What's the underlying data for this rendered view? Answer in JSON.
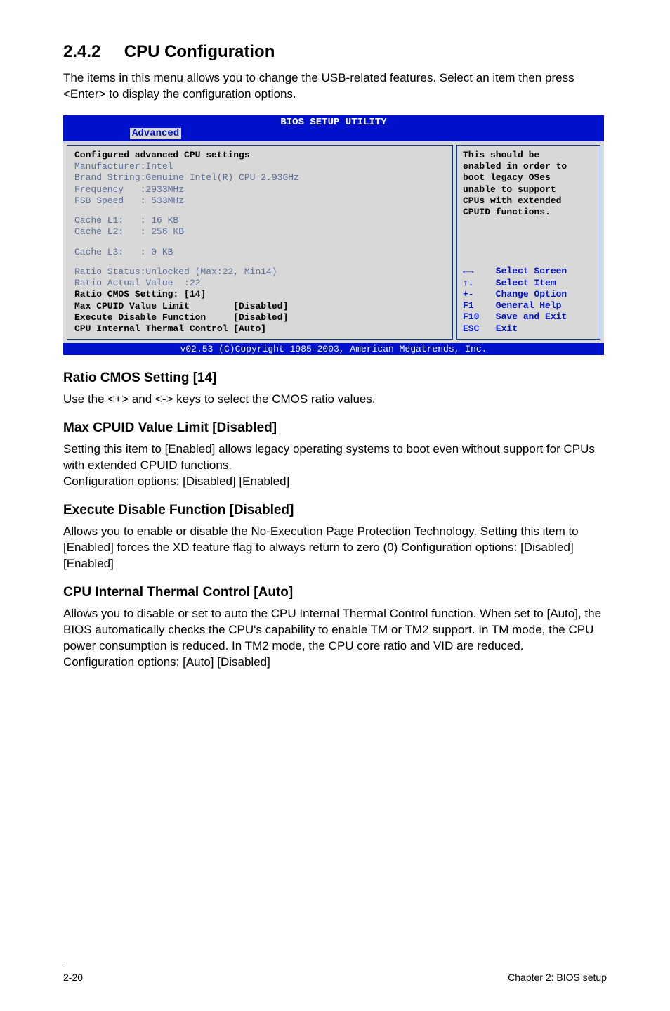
{
  "section": {
    "number": "2.4.2",
    "title": "CPU Configuration",
    "intro": "The items in this menu allows you to change the USB-related features. Select an item then press <Enter> to display the configuration options."
  },
  "bios": {
    "title": "BIOS SETUP UTILITY",
    "tab": "Advanced",
    "left": {
      "heading": "Configured advanced CPU settings",
      "l1": "Manufacturer:Intel",
      "l2": "Brand String:Genuine Intel(R) CPU 2.93GHz",
      "l3": "Frequency   :2933MHz",
      "l4": "FSB Speed   : 533MHz",
      "l5": "Cache L1:   : 16 KB",
      "l6": "Cache L2:   : 256 KB",
      "l7": "Cache L3:   : 0 KB",
      "l8": "Ratio Status:Unlocked (Max:22, Min14)",
      "l9": "Ratio Actual Value  :22",
      "l10": "Ratio CMOS Setting: [14]",
      "l11": "Max CPUID Value Limit        [Disabled]",
      "l12": "Execute Disable Function     [Disabled]",
      "l13": "CPU Internal Thermal Control [Auto]"
    },
    "right": {
      "help": "This should be\nenabled in order to\nboot legacy OSes\nunable to support\nCPUs with extended\nCPUID functions.",
      "nav": "←→    Select Screen\n↑↓    Select Item\n+-    Change Option\nF1    General Help\nF10   Save and Exit\nESC   Exit"
    },
    "footer": "v02.53 (C)Copyright 1985-2003, American Megatrends, Inc."
  },
  "sub1": {
    "title": "Ratio CMOS Setting [14]",
    "body": "Use the <+> and <-> keys to select the CMOS ratio values."
  },
  "sub2": {
    "title": "Max CPUID Value Limit [Disabled]",
    "body": "Setting this item to [Enabled] allows legacy operating systems to boot even without support for CPUs with extended CPUID functions.\nConfiguration options: [Disabled] [Enabled]"
  },
  "sub3": {
    "title": "Execute Disable Function [Disabled]",
    "body": "Allows you to enable or disable the No-Execution Page Protection Technology. Setting this item to [Enabled] forces the XD feature flag to always return to zero (0) Configuration options: [Disabled] [Enabled]"
  },
  "sub4": {
    "title": "CPU Internal Thermal Control [Auto]",
    "body": "Allows you to disable or set to auto the CPU Internal Thermal Control function. When set to [Auto], the BIOS automatically checks the CPU's capability to enable TM or TM2 support. In TM mode, the CPU power consumption is reduced. In TM2 mode, the CPU core ratio and VID are reduced.\nConfiguration options: [Auto] [Disabled]"
  },
  "footer": {
    "left": "2-20",
    "right": "Chapter 2: BIOS setup"
  },
  "chart_data": {
    "type": "table",
    "title": "Configured advanced CPU settings",
    "rows": [
      {
        "field": "Manufacturer",
        "value": "Intel"
      },
      {
        "field": "Brand String",
        "value": "Genuine Intel(R) CPU 2.93GHz"
      },
      {
        "field": "Frequency",
        "value": "2933MHz"
      },
      {
        "field": "FSB Speed",
        "value": "533MHz"
      },
      {
        "field": "Cache L1",
        "value": "16 KB"
      },
      {
        "field": "Cache L2",
        "value": "256 KB"
      },
      {
        "field": "Cache L3",
        "value": "0 KB"
      },
      {
        "field": "Ratio Status",
        "value": "Unlocked (Max:22, Min14)"
      },
      {
        "field": "Ratio Actual Value",
        "value": "22"
      },
      {
        "field": "Ratio CMOS Setting",
        "value": "[14]"
      },
      {
        "field": "Max CPUID Value Limit",
        "value": "[Disabled]"
      },
      {
        "field": "Execute Disable Function",
        "value": "[Disabled]"
      },
      {
        "field": "CPU Internal Thermal Control",
        "value": "[Auto]"
      }
    ]
  }
}
